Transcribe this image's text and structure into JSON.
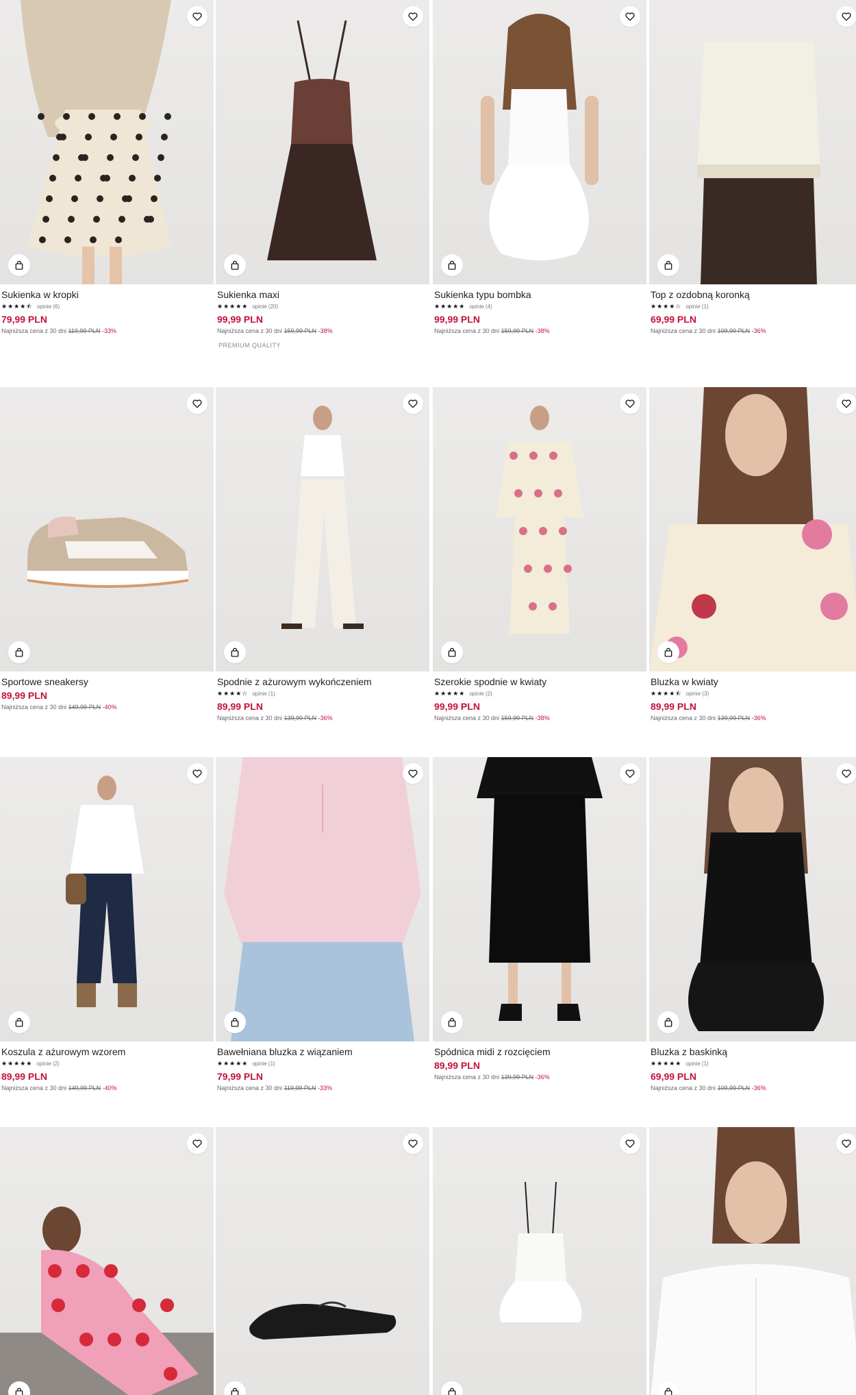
{
  "lowest_price_label": "Najniższa cena z 30 dni",
  "colors": {
    "price": "#c4123a",
    "discount": "#c4123a",
    "text": "#222222",
    "image_bg": "#e8e7e6"
  },
  "icons": {
    "favorite": "heart-icon",
    "add_to_cart": "shopping-bag-icon"
  },
  "products": [
    {
      "name": "Sukienka w kropki",
      "stars": "★★★★⯪",
      "reviews": "opinie (6)",
      "price": "79,99 PLN",
      "old_price": "119,99 PLN",
      "discount": "-33%",
      "image": "polka-dot-dress"
    },
    {
      "name": "Sukienka maxi",
      "stars": "★★★★★",
      "reviews": "opinie (20)",
      "price": "99,99 PLN",
      "old_price": "159,99 PLN",
      "discount": "-38%",
      "badge": "PREMIUM QUALITY",
      "image": "brown-maxi-dress"
    },
    {
      "name": "Sukienka typu bombka",
      "stars": "★★★★★",
      "reviews": "opinie (4)",
      "price": "99,99 PLN",
      "old_price": "159,99 PLN",
      "discount": "-38%",
      "image": "white-bubble-dress"
    },
    {
      "name": "Top z ozdobną koronką",
      "stars": "★★★★☆",
      "reviews": "opinie (1)",
      "price": "69,99 PLN",
      "old_price": "109,99 PLN",
      "discount": "-36%",
      "image": "lace-top"
    },
    {
      "name": "Sportowe sneakersy",
      "price": "89,99 PLN",
      "old_price": "149,99 PLN",
      "discount": "-40%",
      "image": "sneaker"
    },
    {
      "name": "Spodnie z ażurowym wykończeniem",
      "stars": "★★★★☆",
      "reviews": "opinie (1)",
      "price": "89,99 PLN",
      "old_price": "139,99 PLN",
      "discount": "-36%",
      "image": "white-trousers"
    },
    {
      "name": "Szerokie spodnie w kwiaty",
      "stars": "★★★★★",
      "reviews": "opinie (2)",
      "price": "99,99 PLN",
      "old_price": "159,99 PLN",
      "discount": "-38%",
      "image": "floral-set"
    },
    {
      "name": "Bluzka w kwiaty",
      "stars": "★★★★⯪",
      "reviews": "opinie (3)",
      "price": "89,99 PLN",
      "old_price": "139,99 PLN",
      "discount": "-36%",
      "image": "floral-blouse"
    },
    {
      "name": "Koszula z ażurowym wzorem",
      "stars": "★★★★★",
      "reviews": "opinie (2)",
      "price": "89,99 PLN",
      "old_price": "149,99 PLN",
      "discount": "-40%",
      "image": "white-shirt-jeans"
    },
    {
      "name": "Bawełniana bluzka z wiązaniem",
      "stars": "★★★★★",
      "reviews": "opinie (1)",
      "price": "79,99 PLN",
      "old_price": "119,99 PLN",
      "discount": "-33%",
      "image": "pink-blouse"
    },
    {
      "name": "Spódnica midi z rozcięciem",
      "price": "89,99 PLN",
      "old_price": "139,99 PLN",
      "discount": "-36%",
      "image": "black-skirt"
    },
    {
      "name": "Bluzka z baskinką",
      "stars": "★★★★★",
      "reviews": "opinie (1)",
      "price": "69,99 PLN",
      "old_price": "109,99 PLN",
      "discount": "-36%",
      "image": "black-peplum-top"
    },
    {
      "image": "pink-floral-dress"
    },
    {
      "image": "black-slipper"
    },
    {
      "image": "white-cami-top"
    },
    {
      "image": "white-shirt"
    }
  ]
}
